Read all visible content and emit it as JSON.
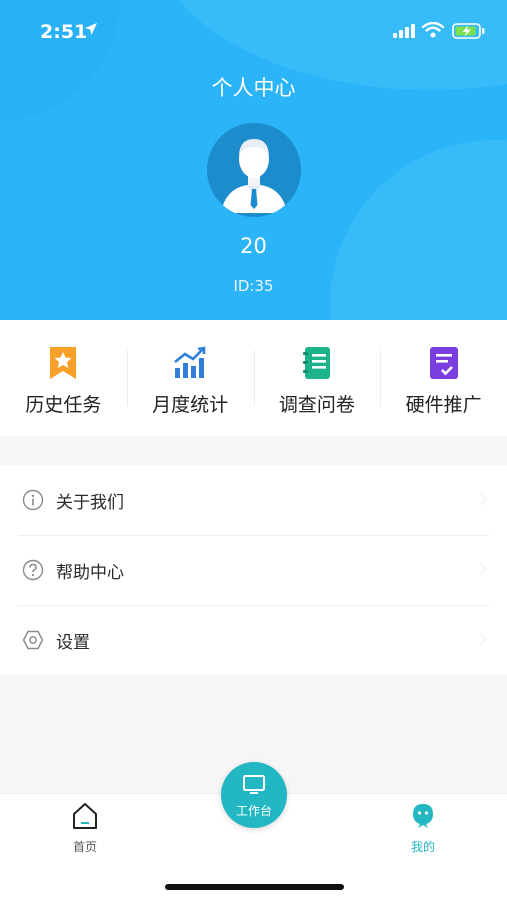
{
  "status_bar": {
    "time": "2:51"
  },
  "header": {
    "title": "个人中心",
    "username": "20",
    "user_id": "ID:35"
  },
  "quick_actions": [
    {
      "label": "历史任务",
      "icon": "bookmark-star-icon",
      "color": "#f7a12a"
    },
    {
      "label": "月度统计",
      "icon": "bar-chart-icon",
      "color": "#2f7fd8"
    },
    {
      "label": "调查问卷",
      "icon": "notebook-icon",
      "color": "#1cb38a"
    },
    {
      "label": "硬件推广",
      "icon": "checklist-icon",
      "color": "#7a3ee0"
    }
  ],
  "menu": [
    {
      "label": "关于我们",
      "icon": "info-icon"
    },
    {
      "label": "帮助中心",
      "icon": "help-icon"
    },
    {
      "label": "设置",
      "icon": "settings-icon"
    }
  ],
  "tabbar": {
    "home_label": "首页",
    "workbench_label": "工作台",
    "me_label": "我的",
    "active_color": "#23b7c3",
    "inactive_color": "#555555"
  },
  "colors": {
    "header": "#2bb4f7",
    "accent": "#23b7c3"
  }
}
